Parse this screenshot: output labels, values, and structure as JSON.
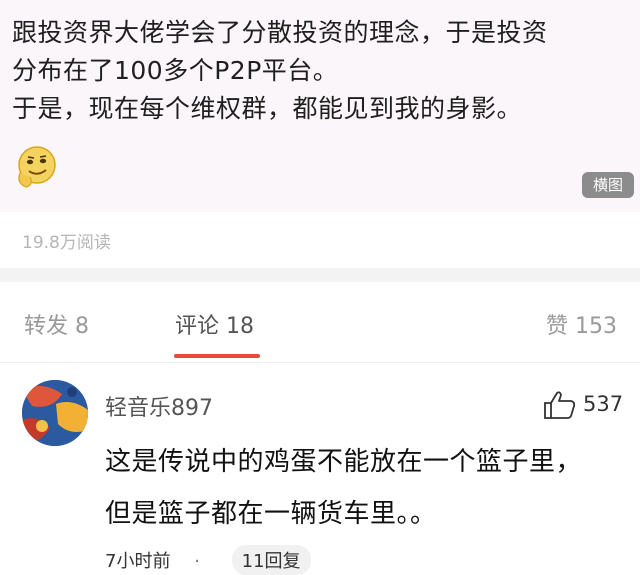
{
  "post": {
    "lines": [
      "跟投资界大佬学会了分散投资的理念，于是投资",
      "分布在了100多个P2P平台。",
      "于是，现在每个维权群，都能见到我的身影。"
    ],
    "emoji": "smirk-emoji-icon",
    "long_image_badge": "横图"
  },
  "read_count": "19.8万阅读",
  "tabs": [
    {
      "label": "转发 8"
    },
    {
      "label": "评论 18"
    },
    {
      "label": "赞 153"
    }
  ],
  "comment": {
    "username": "轻音乐897",
    "like_count": "537",
    "lines": [
      "这是传说中的鸡蛋不能放在一个篮子里，",
      "但是篮子都在一辆货车里。。"
    ],
    "time": "7小时前",
    "separator": "·",
    "replies": "11回复"
  },
  "colors": {
    "accent": "#e94a3a",
    "post_bg": "#fbf6f9"
  }
}
